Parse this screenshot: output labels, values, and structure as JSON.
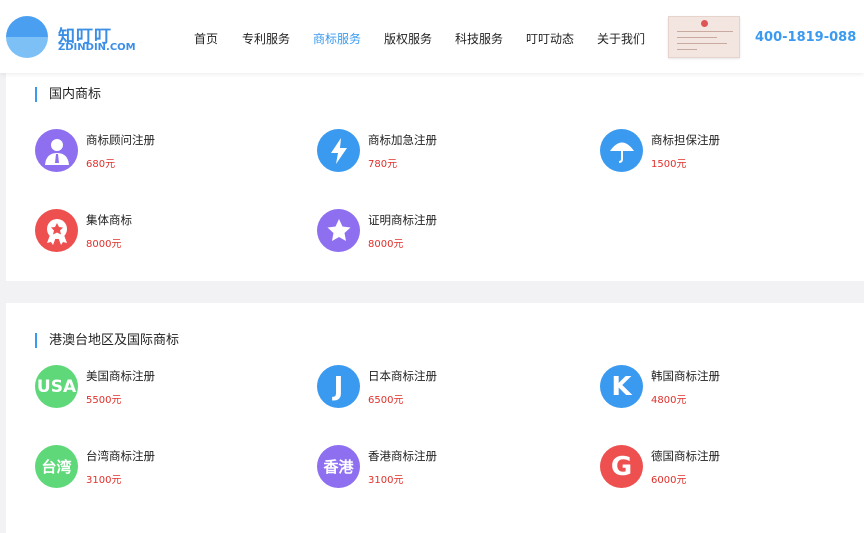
{
  "header": {
    "logo_cn": "知叮叮",
    "logo_en": "ZDINDIN.COM",
    "nav": [
      "首页",
      "专利服务",
      "商标服务",
      "版权服务",
      "科技服务",
      "叮叮动态",
      "关于我们"
    ],
    "active_nav": "商标服务",
    "phone": "400-1819-088"
  },
  "sections": [
    {
      "title": "国内商标",
      "items": [
        {
          "name": "商标顾问注册",
          "price": "680元",
          "icon": "person-icon",
          "color": "#8d6ff0"
        },
        {
          "name": "商标加急注册",
          "price": "780元",
          "icon": "lightning-icon",
          "color": "#3a9af0"
        },
        {
          "name": "商标担保注册",
          "price": "1500元",
          "icon": "umbrella-icon",
          "color": "#3a9af0"
        },
        {
          "name": "集体商标",
          "price": "8000元",
          "icon": "medal-icon",
          "color": "#ee5050"
        },
        {
          "name": "证明商标注册",
          "price": "8000元",
          "icon": "star-badge-icon",
          "color": "#8d6ff0"
        }
      ]
    },
    {
      "title": "港澳台地区及国际商标",
      "items": [
        {
          "name": "美国商标注册",
          "price": "5500元",
          "icon": "usa-icon",
          "glyph": "USA",
          "color": "#5fd87a"
        },
        {
          "name": "日本商标注册",
          "price": "6500元",
          "icon": "japan-icon",
          "glyph": "J",
          "color": "#3a9af0"
        },
        {
          "name": "韩国商标注册",
          "price": "4800元",
          "icon": "korea-icon",
          "glyph": "K",
          "color": "#3a9af0"
        },
        {
          "name": "台湾商标注册",
          "price": "3100元",
          "icon": "taiwan-icon",
          "glyph": "台湾",
          "color": "#5fd87a"
        },
        {
          "name": "香港商标注册",
          "price": "3100元",
          "icon": "hongkong-icon",
          "glyph": "香港",
          "color": "#8d6ff0"
        },
        {
          "name": "德国商标注册",
          "price": "6000元",
          "icon": "germany-icon",
          "glyph": "G",
          "color": "#ee5050"
        }
      ]
    }
  ]
}
